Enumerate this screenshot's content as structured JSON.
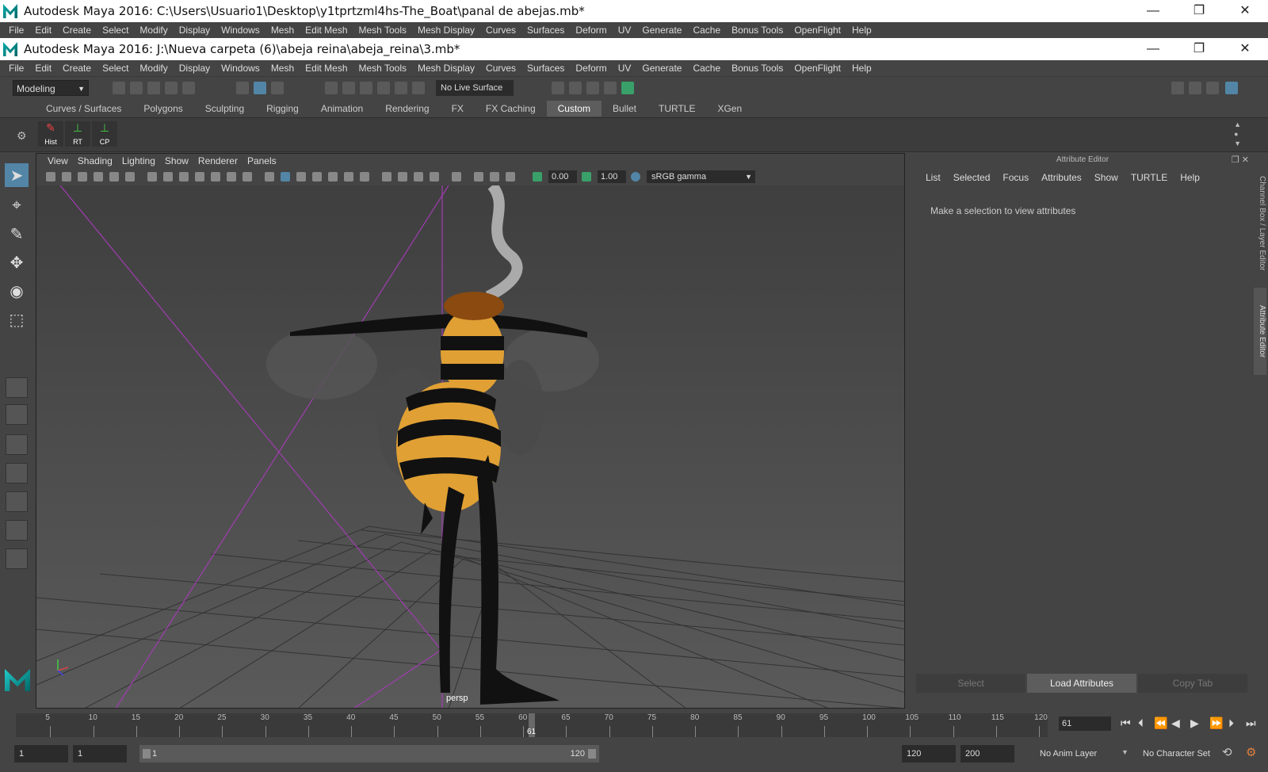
{
  "outer_window": {
    "title": "Autodesk Maya 2016: C:\\Users\\Usuario1\\Desktop\\y1tprtzml4hs-The_Boat\\panal de abejas.mb*",
    "controls": [
      "—",
      "❐",
      "✕"
    ]
  },
  "outer_menu": [
    "File",
    "Edit",
    "Create",
    "Select",
    "Modify",
    "Display",
    "Windows",
    "Mesh",
    "Edit Mesh",
    "Mesh Tools",
    "Mesh Display",
    "Curves",
    "Surfaces",
    "Deform",
    "UV",
    "Generate",
    "Cache",
    "Bonus Tools",
    "OpenFlight",
    "Help"
  ],
  "inner_window": {
    "title": "Autodesk Maya 2016: J:\\Nueva carpeta (6)\\abeja reina\\abeja_reina\\3.mb*",
    "controls": [
      "—",
      "❐",
      "✕"
    ]
  },
  "inner_menu": [
    "File",
    "Edit",
    "Create",
    "Select",
    "Modify",
    "Display",
    "Windows",
    "Mesh",
    "Edit Mesh",
    "Mesh Tools",
    "Mesh Display",
    "Curves",
    "Surfaces",
    "Deform",
    "UV",
    "Generate",
    "Cache",
    "Bonus Tools",
    "OpenFlight",
    "Help"
  ],
  "toolbar": {
    "menuset": "Modeling",
    "live_surface": "No Live Surface"
  },
  "shelf": {
    "tabs": [
      "Curves / Surfaces",
      "Polygons",
      "Sculpting",
      "Rigging",
      "Animation",
      "Rendering",
      "FX",
      "FX Caching",
      "Custom",
      "Bullet",
      "TURTLE",
      "XGen"
    ],
    "active_tab": "Custom",
    "buttons": [
      {
        "label": "Hist",
        "icon": "history-icon"
      },
      {
        "label": "RT",
        "icon": "rt-axis-icon"
      },
      {
        "label": "CP",
        "icon": "cp-axis-icon"
      }
    ]
  },
  "viewport": {
    "menu": [
      "View",
      "Shading",
      "Lighting",
      "Show",
      "Renderer",
      "Panels"
    ],
    "exposure": "0.00",
    "gamma": "1.00",
    "color_space": "sRGB gamma",
    "camera": "persp"
  },
  "attribute_editor": {
    "title": "Attribute Editor",
    "menu": [
      "List",
      "Selected",
      "Focus",
      "Attributes",
      "Show",
      "TURTLE",
      "Help"
    ],
    "message": "Make a selection to view attributes",
    "buttons": [
      "Select",
      "Load Attributes",
      "Copy Tab"
    ]
  },
  "side_tabs": [
    "Channel Box / Layer Editor",
    "Attribute Editor"
  ],
  "time_slider": {
    "ticks": [
      "5",
      "10",
      "15",
      "20",
      "25",
      "30",
      "35",
      "40",
      "45",
      "50",
      "55",
      "60",
      "65",
      "70",
      "75",
      "80",
      "85",
      "90",
      "95",
      "100",
      "105",
      "110",
      "115",
      "120"
    ],
    "current_frame": "61",
    "frame_field": "61"
  },
  "range_slider": {
    "start": "1",
    "anim_start": "1",
    "range_start": "1",
    "range_end": "120",
    "playback_end": "120",
    "anim_end": "200",
    "anim_layer": "No Anim Layer",
    "character_set": "No Character Set"
  }
}
